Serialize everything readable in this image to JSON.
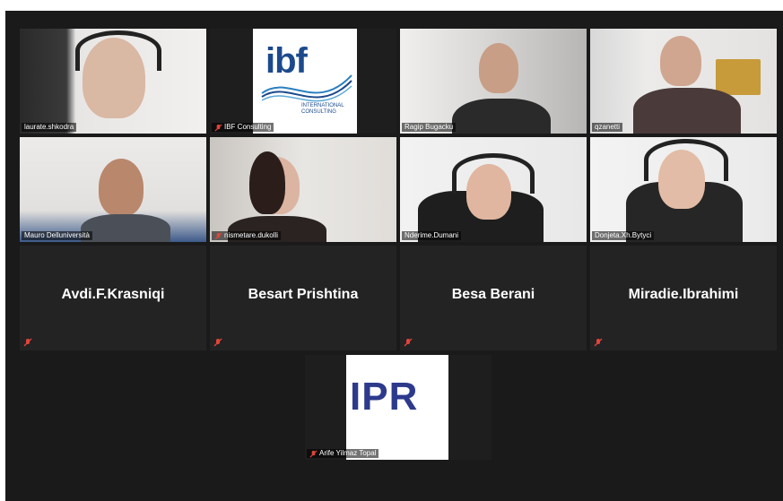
{
  "participants": [
    {
      "name": "laurate.shkodra",
      "muted": false
    },
    {
      "name": "IBF Consulting",
      "muted": true
    },
    {
      "name": "Ragip Bugacku",
      "muted": false
    },
    {
      "name": "qzanetti",
      "muted": false,
      "active_speaker": true
    },
    {
      "name": "Mauro Delluniversità",
      "muted": false
    },
    {
      "name": "nismetare.dukolli",
      "muted": true
    },
    {
      "name": "Nderime.Dumani",
      "muted": false
    },
    {
      "name": "Donjeta.Xh.Bytyci",
      "muted": false
    },
    {
      "name": "Avdi.F.Krasniqi",
      "muted": true
    },
    {
      "name": "Besart Prishtina",
      "muted": true
    },
    {
      "name": "Besa Berani",
      "muted": true
    },
    {
      "name": "Miradie.Ibrahimi",
      "muted": true
    },
    {
      "name": "Arife Yilmaz Topal",
      "muted": true
    }
  ],
  "logos": {
    "ibf_main": "ibf",
    "ibf_sub": "INTERNATIONAL CONSULTING",
    "ipr": "IPR"
  },
  "colors": {
    "background": "#1a1a1a",
    "active_border": "#c7d13a",
    "mute_icon": "#e0453a"
  }
}
